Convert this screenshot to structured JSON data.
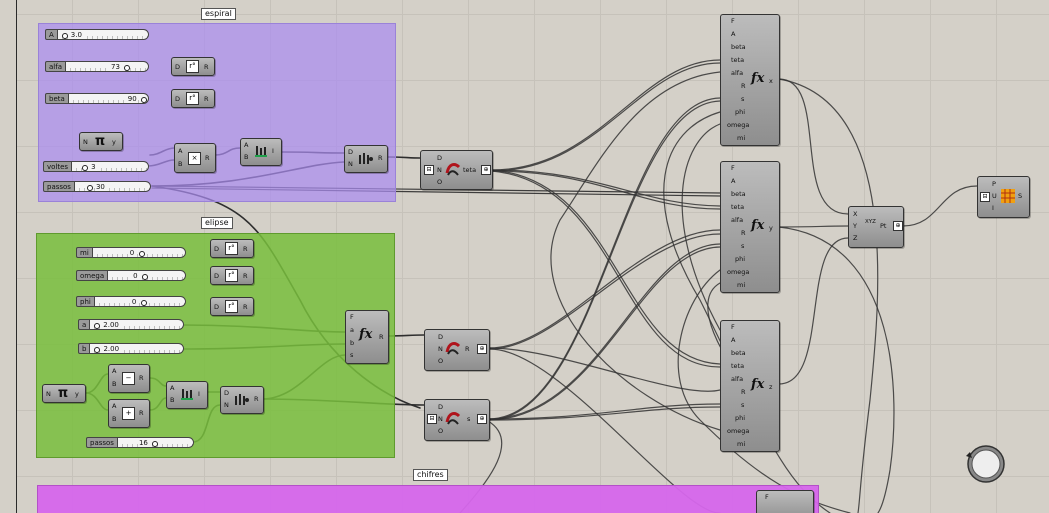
{
  "groups": {
    "espiral": "espiral",
    "elipse": "elipse",
    "chifres": "chifres"
  },
  "sliders": {
    "A": {
      "label": "A",
      "value": "3.0"
    },
    "alfa": {
      "label": "alfa",
      "value": "73"
    },
    "beta": {
      "label": "beta",
      "value": "90"
    },
    "voltes": {
      "label": "voltes",
      "value": "3"
    },
    "passos1": {
      "label": "passos",
      "value": "30"
    },
    "mi": {
      "label": "mi",
      "value": "0"
    },
    "omega": {
      "label": "omega",
      "value": "0"
    },
    "phi": {
      "label": "phi",
      "value": "0"
    },
    "a": {
      "label": "a",
      "value": "2.00"
    },
    "b": {
      "label": "b",
      "value": "2.00"
    },
    "passos2": {
      "label": "passos",
      "value": "16"
    }
  },
  "ports": {
    "D": "D",
    "R": "R",
    "A": "A",
    "B": "B",
    "N": "N",
    "O": "O",
    "I": "I",
    "F": "F",
    "a": "a",
    "b": "b",
    "s": "s",
    "y": "y",
    "x": "x",
    "z": "z",
    "X": "X",
    "Y": "Y",
    "Z": "Z",
    "Pt": "Pt",
    "P": "P",
    "U": "U",
    "S": "S",
    "teta": "teta",
    "alfa": "alfa",
    "beta": "beta",
    "phi": "phi",
    "omega": "omega",
    "mi": "mi"
  },
  "icons": {
    "degrees": "degrees-icon",
    "pi": "pi-icon",
    "multiply": "multiply-icon",
    "subtract": "subtract-icon",
    "add": "add-icon",
    "division": "division-icon",
    "range": "range-icon",
    "expression": "expression-icon",
    "construct_point": "construct-point-icon",
    "nurbs_curve": "nurbs-curve-icon",
    "navigation": "navigation-wheel-icon"
  },
  "glyphs": {
    "pi": "π",
    "multiply": "×",
    "subtract": "−",
    "add": "+",
    "degrees": "r°",
    "fx": "fx",
    "xyz": "XYZ"
  },
  "colors": {
    "canvas": "#d4d0c8",
    "group_espiral": "#aa8cf0",
    "group_elipse": "#78be3c",
    "group_chifres": "#d666ec",
    "component": "#a6a6a6"
  }
}
